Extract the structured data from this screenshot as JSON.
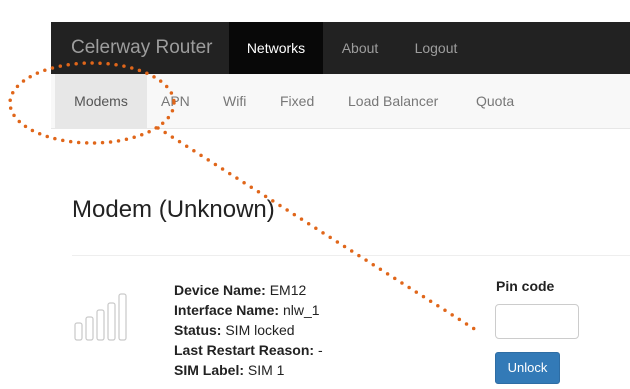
{
  "navbar": {
    "brand": "Celerway Router",
    "items": [
      {
        "label": "Networks",
        "active": true
      },
      {
        "label": "About",
        "active": false
      },
      {
        "label": "Logout",
        "active": false
      }
    ]
  },
  "subnav": {
    "items": [
      {
        "label": "Modems",
        "active": true
      },
      {
        "label": "APN",
        "active": false
      },
      {
        "label": "Wifi",
        "active": false
      },
      {
        "label": "Fixed",
        "active": false
      },
      {
        "label": "Load Balancer",
        "active": false
      },
      {
        "label": "Quota",
        "active": false
      }
    ]
  },
  "page": {
    "title": "Modem (Unknown)"
  },
  "modem": {
    "fields": [
      {
        "label": "Device Name:",
        "value": "EM12"
      },
      {
        "label": "Interface Name:",
        "value": "nlw_1"
      },
      {
        "label": "Status:",
        "value": "SIM locked"
      },
      {
        "label": "Last Restart Reason:",
        "value": "-"
      },
      {
        "label": "SIM Label:",
        "value": "SIM 1"
      }
    ],
    "signal_icon": "signal-bars-icon",
    "signal_level": 0
  },
  "pin": {
    "label": "Pin code",
    "value": "",
    "placeholder": "",
    "unlock_label": "Unlock"
  },
  "colors": {
    "navbar_bg": "#222222",
    "button_primary": "#337ab7",
    "annotation": "#e0661a"
  }
}
